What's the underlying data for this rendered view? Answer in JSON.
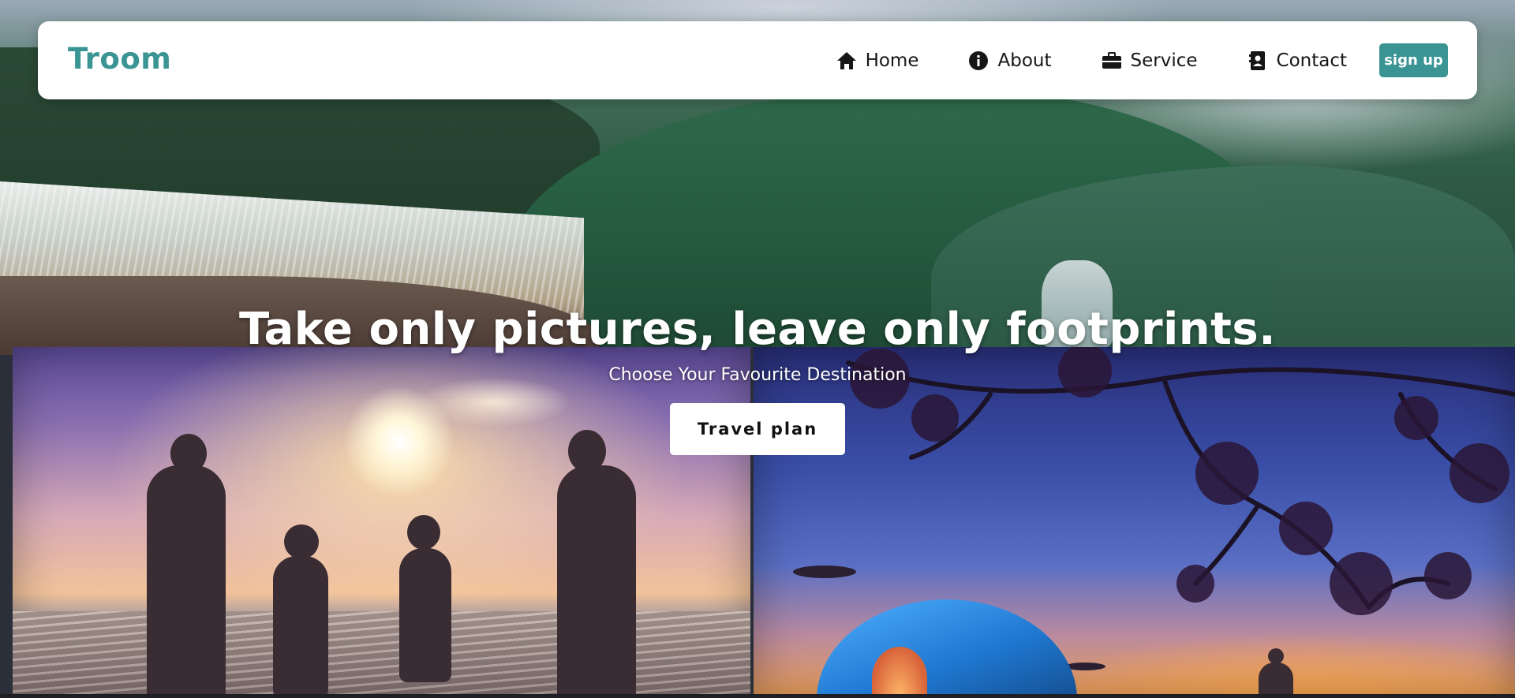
{
  "navbar": {
    "brand": "Troom",
    "links": [
      {
        "label": "Home",
        "icon": "home-icon"
      },
      {
        "label": "About",
        "icon": "info-icon"
      },
      {
        "label": "Service",
        "icon": "briefcase-icon"
      },
      {
        "label": "Contact",
        "icon": "contact-book-icon"
      }
    ],
    "signup_label": "sign up"
  },
  "hero": {
    "title": "Take only pictures, leave only footprints.",
    "subtitle": "Choose Your Favourite Destination",
    "cta_label": "Travel plan"
  },
  "colors": {
    "accent": "#3a9494",
    "navbar_bg": "#ffffff",
    "text_dark": "#161616",
    "hero_text": "#ffffff"
  }
}
